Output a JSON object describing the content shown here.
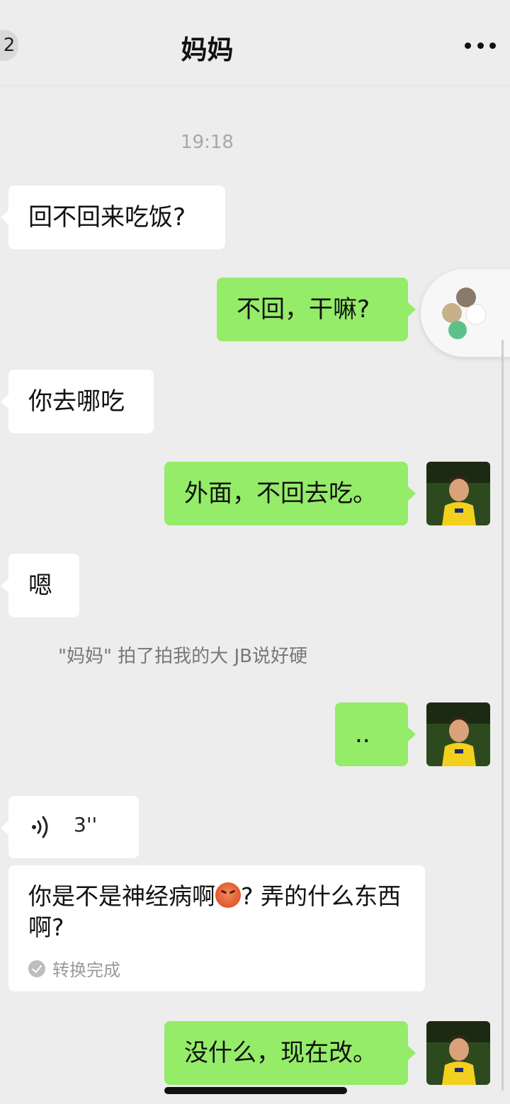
{
  "header": {
    "back_badge": "2",
    "title": "妈妈",
    "more_icon": "more-icon"
  },
  "timestamp": "19:18",
  "messages": [
    {
      "side": "left",
      "text": "回不回来吃饭?"
    },
    {
      "side": "right",
      "text": "不回，干嘛?"
    },
    {
      "side": "left",
      "text": "你去哪吃"
    },
    {
      "side": "right",
      "text": "外面，不回去吃。"
    },
    {
      "side": "left",
      "text": "嗯"
    },
    {
      "side": "right",
      "text": ".."
    },
    {
      "side": "right",
      "text": "没什么，现在改。"
    }
  ],
  "system_message": "\"妈妈\" 拍了拍我的大 JB说好硬",
  "voice": {
    "icon": "voice-wave-icon",
    "duration": "3''",
    "transcript_part1": "你是不是神经病啊",
    "transcript_emoji": "angry-face-icon",
    "transcript_part2": "? 弄的什么东西啊?",
    "status": "转换完成"
  },
  "colors": {
    "background": "#ededed",
    "bubble_left": "#ffffff",
    "bubble_right": "#95ec69"
  }
}
